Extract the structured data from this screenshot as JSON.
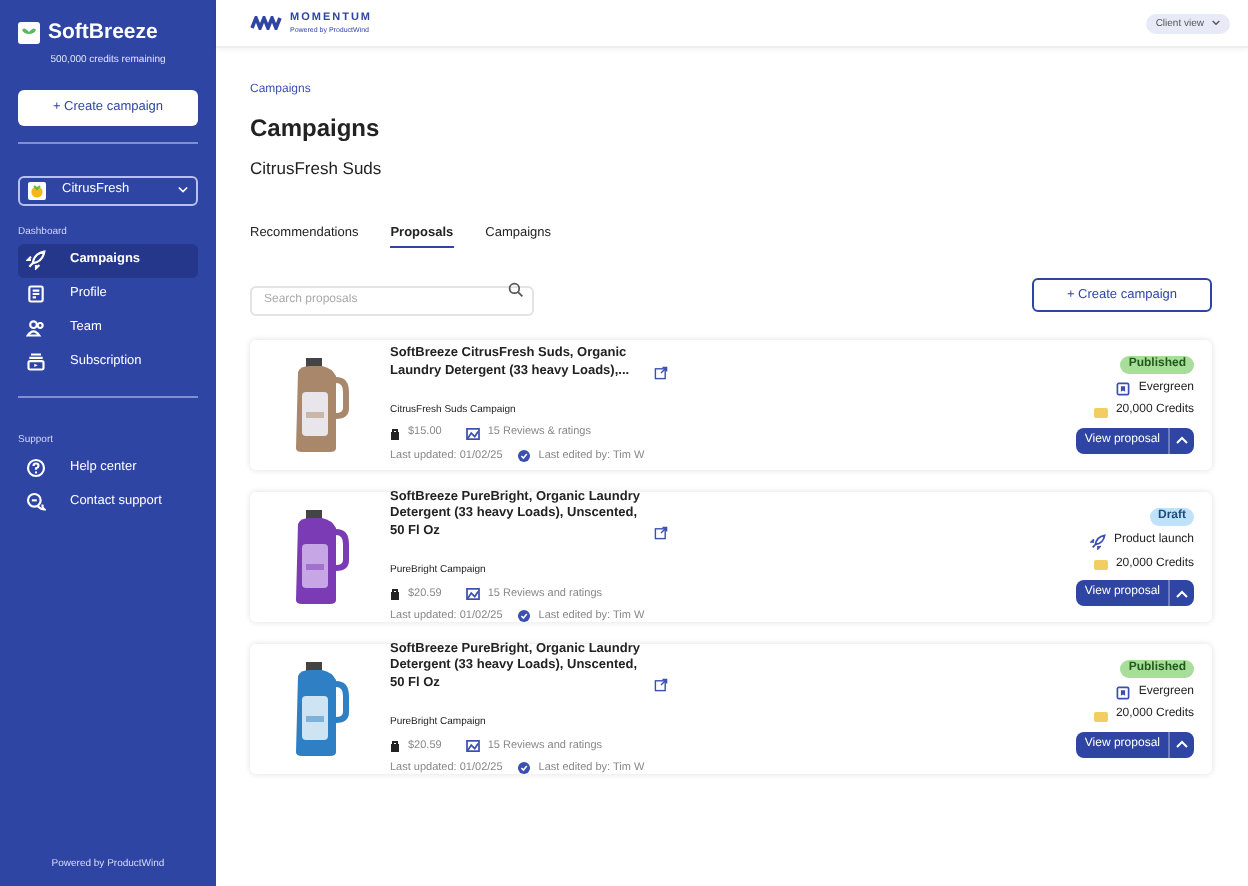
{
  "sidebar": {
    "brand": "SoftBreeze",
    "credits": "500,000 credits remaining",
    "create_button": "+ Create campaign",
    "brand_select": "CitrusFresh",
    "sections": [
      {
        "heading": "Dashboard",
        "items": [
          {
            "label": "Campaigns",
            "kind": "rocket",
            "selected": true
          },
          {
            "label": "Profile",
            "kind": "document",
            "selected": false
          },
          {
            "label": "Team",
            "kind": "people",
            "selected": false
          },
          {
            "label": "Subscription",
            "kind": "subscription",
            "selected": false
          }
        ]
      },
      {
        "heading": "Support",
        "items": [
          {
            "label": "Help center",
            "kind": "help",
            "selected": false
          },
          {
            "label": "Contact support",
            "kind": "chat",
            "selected": false
          }
        ]
      }
    ],
    "footer": "Powered by ProductWind"
  },
  "topbar": {
    "logo": "MOMENTUM",
    "logo_sub": "Powered by ProductWind",
    "view_select": "Client view"
  },
  "breadcrumb": "Campaigns",
  "page_title": "Campaigns",
  "subtitle": "CitrusFresh Suds",
  "tabs": [
    {
      "label": "Recommendations",
      "selected": false
    },
    {
      "label": "Proposals",
      "selected": true
    },
    {
      "label": "Campaigns",
      "selected": false
    }
  ],
  "search": {
    "placeholder": "Search proposals"
  },
  "create_button": "+ Create campaign",
  "proposals": [
    {
      "title": "SoftBreeze CitrusFresh Suds, Organic Laundry Detergent (33 heavy Loads),...",
      "campaign": "CitrusFresh Suds Campaign",
      "price": "$15.00",
      "reviews": "15 Reviews & ratings",
      "updated": "Last updated: 01/02/25",
      "edited_by": "Last edited by: Tim W",
      "status": {
        "label": "Published",
        "kind": "published"
      },
      "type": {
        "label": "Evergreen",
        "kind": "evergreen"
      },
      "credits": "20,000 Credits",
      "action": "View proposal",
      "kind": "picture"
    },
    {
      "title": "SoftBreeze PureBright, Organic Laundry Detergent (33 heavy Loads), Unscented, 50 Fl Oz",
      "campaign": "PureBright Campaign",
      "price": "$20.59",
      "reviews": "15 Reviews and ratings",
      "updated": "Last updated: 01/02/25",
      "edited_by": "Last edited by: Tim W",
      "status": {
        "label": "Draft",
        "kind": "draft"
      },
      "type": {
        "label": "Product launch",
        "kind": "launch"
      },
      "credits": "20,000 Credits",
      "action": "View proposal",
      "kind": "picture"
    },
    {
      "title": "SoftBreeze PureBright, Organic Laundry Detergent (33 heavy Loads), Unscented, 50 Fl Oz",
      "campaign": "PureBright Campaign",
      "price": "$20.59",
      "reviews": "15 Reviews and ratings",
      "updated": "Last updated: 01/02/25",
      "edited_by": "Last edited by: Tim W",
      "status": {
        "label": "Published",
        "kind": "published"
      },
      "type": {
        "label": "Evergreen",
        "kind": "evergreen"
      },
      "credits": "20,000 Credits",
      "action": "View proposal",
      "kind": "picture"
    }
  ]
}
